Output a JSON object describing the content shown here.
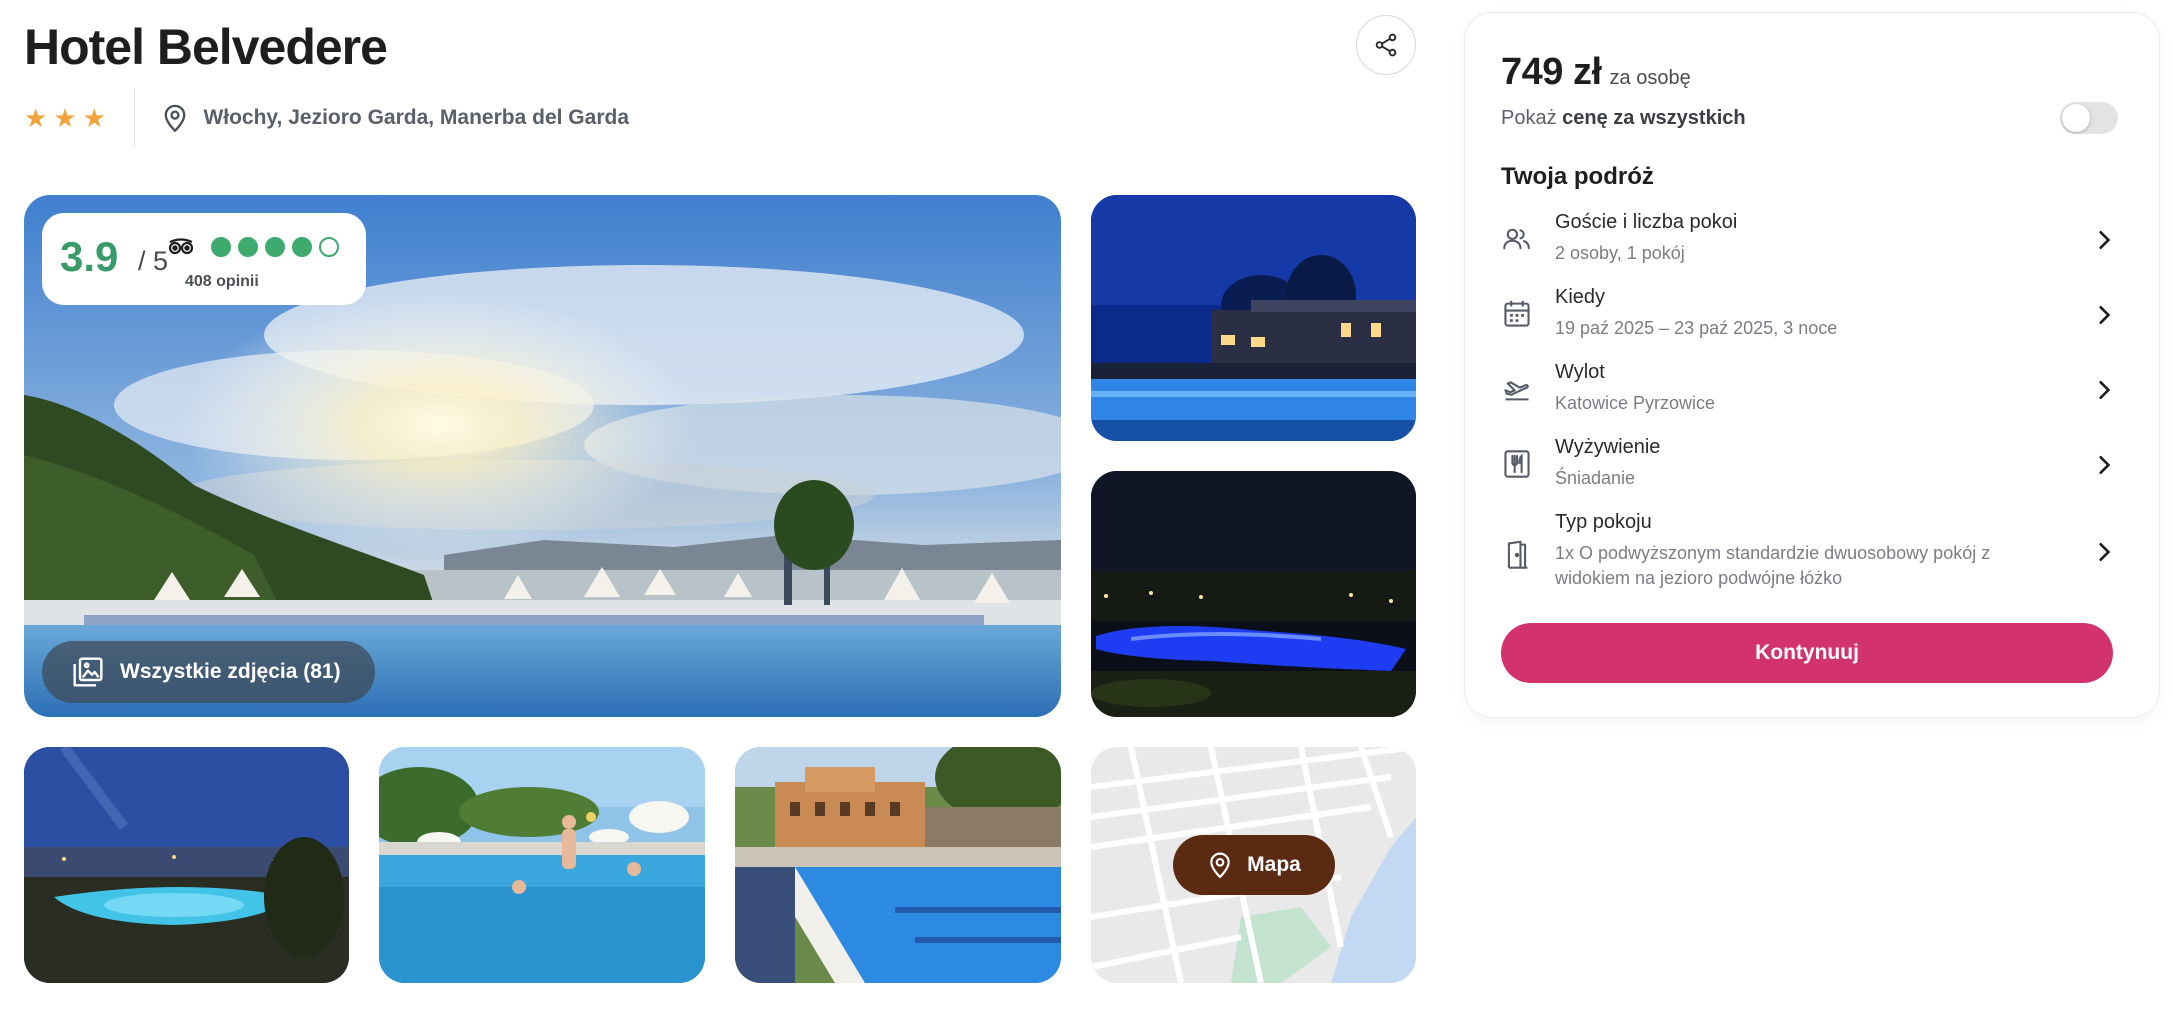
{
  "hotel": {
    "name": "Hotel Belvedere",
    "stars": 3,
    "location": "Włochy, Jezioro Garda, Manerba del Garda"
  },
  "icons": {
    "share": "share-icon",
    "location": "map-pin-icon",
    "star": "star-icon",
    "tripadvisor": "tripadvisor-owl-icon",
    "gallery": "photo-gallery-icon",
    "map": "map-pin-icon"
  },
  "rating": {
    "score": "3.9",
    "max": "/ 5",
    "reviews": "408 opinii",
    "dots_filled": 4,
    "dots_total": 5
  },
  "gallery": {
    "all_photos_label": "Wszystkie zdjęcia (81)",
    "map_label": "Mapa"
  },
  "booking": {
    "price": "749 zł",
    "price_unit": "za osobę",
    "show_all_prefix": "Pokaż",
    "show_all_bold": "cenę za wszystkich",
    "toggle_on": false,
    "trip_heading": "Twoja podróż",
    "rows": [
      {
        "icon": "users-icon",
        "label": "Goście i liczba pokoi",
        "value": "2 osoby, 1 pokój"
      },
      {
        "icon": "calendar-icon",
        "label": "Kiedy",
        "value": "19 paź 2025 – 23 paź 2025, 3 noce"
      },
      {
        "icon": "plane-departure-icon",
        "label": "Wylot",
        "value": "Katowice Pyrzowice"
      },
      {
        "icon": "cutlery-icon",
        "label": "Wyżywienie",
        "value": "Śniadanie"
      },
      {
        "icon": "door-icon",
        "label": "Typ pokoju",
        "value": "1x O podwyższonym standardzie dwuosobowy pokój z widokiem na jezioro podwójne łóżko"
      }
    ],
    "cta": "Kontynuuj"
  },
  "colors": {
    "accent": "#d2336f",
    "rating_green": "#3faa6d",
    "star_orange": "#f2a43c",
    "map_button": "#5a2a12"
  }
}
